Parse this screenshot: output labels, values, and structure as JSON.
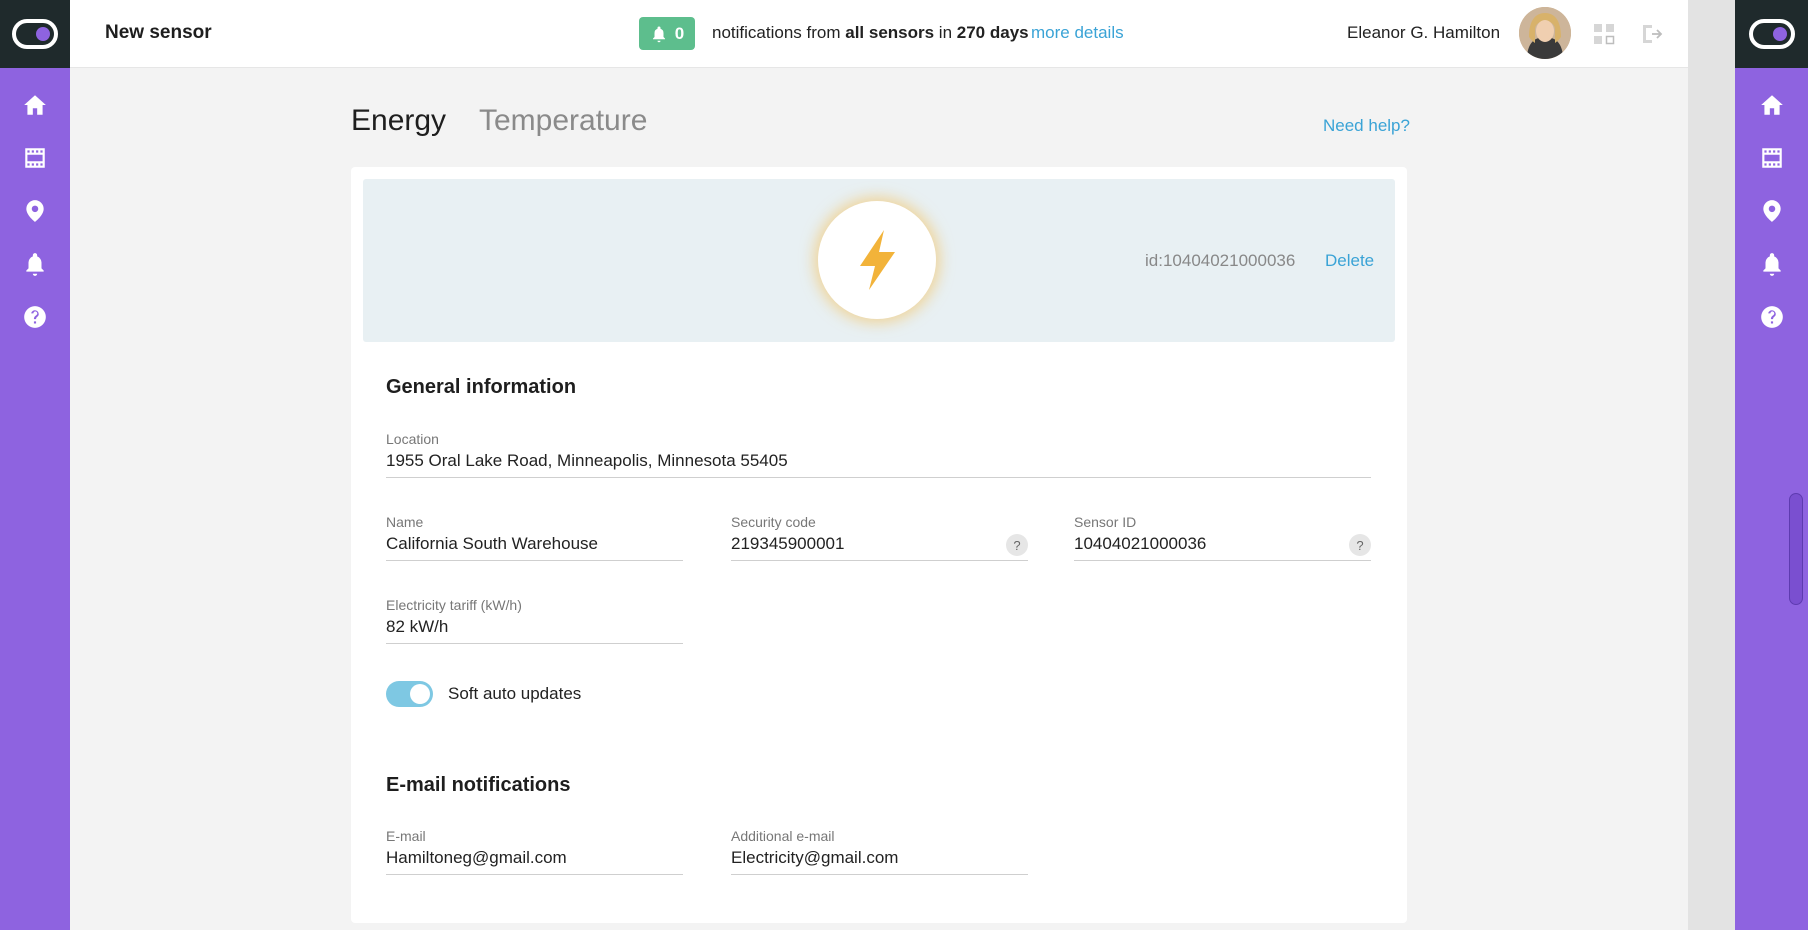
{
  "header": {
    "title": "New sensor",
    "notifications": {
      "count": "0",
      "text_prefix": "notifications from",
      "text_bold_1": "all sensors",
      "text_mid": "in",
      "text_bold_2": "270 days",
      "more_link": "more details"
    },
    "user_name": "Eleanor G. Hamilton"
  },
  "sidebar": {
    "items": [
      {
        "icon": "home-icon"
      },
      {
        "icon": "sensor-list-icon"
      },
      {
        "icon": "location-pin-icon"
      },
      {
        "icon": "bell-icon"
      },
      {
        "icon": "help-icon"
      }
    ]
  },
  "tabs": {
    "energy": "Energy",
    "temperature": "Temperature",
    "active": "Energy",
    "help_link": "Need help?"
  },
  "sensor": {
    "id_label": "id:10404021000036",
    "delete_label": "Delete"
  },
  "general": {
    "title": "General information",
    "location": {
      "label": "Location",
      "value": "1955 Oral Lake Road, Minneapolis, Minnesota 55405"
    },
    "name": {
      "label": "Name",
      "value": "California South Warehouse"
    },
    "security_code": {
      "label": "Security code",
      "value": "219345900001",
      "help": "?"
    },
    "sensor_id": {
      "label": "Sensor ID",
      "value": "10404021000036",
      "help": "?"
    },
    "tariff": {
      "label": "Electricity tariff (kW/h)",
      "value": "82 kW/h"
    },
    "auto_updates": {
      "label": "Soft auto updates",
      "enabled": true
    }
  },
  "email": {
    "title": "E-mail notifications",
    "email": {
      "label": "E-mail",
      "value": "Hamiltoneg@gmail.com"
    },
    "additional": {
      "label": "Additional e-mail",
      "value": "Electricity@gmail.com"
    }
  },
  "colors": {
    "accent_purple": "#8e63e0",
    "badge_green": "#5dbe8d",
    "link_blue": "#3aa3d6",
    "toggle_blue": "#7ec8e3"
  }
}
